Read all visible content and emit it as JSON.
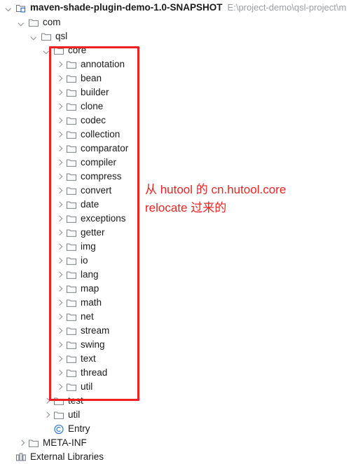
{
  "project": {
    "name": "maven-shade-plugin-demo-1.0-SNAPSHOT",
    "path": "E:\\project-demo\\qsl-project\\m",
    "icon": "project-folder-icon",
    "expanded": true
  },
  "tree": [
    {
      "label": "com",
      "icon": "folder-icon",
      "state": "expanded",
      "depth": 1
    },
    {
      "label": "qsl",
      "icon": "folder-icon",
      "state": "expanded",
      "depth": 2
    },
    {
      "label": "core",
      "icon": "folder-icon",
      "state": "expanded",
      "depth": 3
    },
    {
      "label": "annotation",
      "icon": "folder-icon",
      "state": "collapsed",
      "depth": 4
    },
    {
      "label": "bean",
      "icon": "folder-icon",
      "state": "collapsed",
      "depth": 4
    },
    {
      "label": "builder",
      "icon": "folder-icon",
      "state": "collapsed",
      "depth": 4
    },
    {
      "label": "clone",
      "icon": "folder-icon",
      "state": "collapsed",
      "depth": 4
    },
    {
      "label": "codec",
      "icon": "folder-icon",
      "state": "collapsed",
      "depth": 4
    },
    {
      "label": "collection",
      "icon": "folder-icon",
      "state": "collapsed",
      "depth": 4
    },
    {
      "label": "comparator",
      "icon": "folder-icon",
      "state": "collapsed",
      "depth": 4
    },
    {
      "label": "compiler",
      "icon": "folder-icon",
      "state": "collapsed",
      "depth": 4
    },
    {
      "label": "compress",
      "icon": "folder-icon",
      "state": "collapsed",
      "depth": 4
    },
    {
      "label": "convert",
      "icon": "folder-icon",
      "state": "collapsed",
      "depth": 4
    },
    {
      "label": "date",
      "icon": "folder-icon",
      "state": "collapsed",
      "depth": 4
    },
    {
      "label": "exceptions",
      "icon": "folder-icon",
      "state": "collapsed",
      "depth": 4
    },
    {
      "label": "getter",
      "icon": "folder-icon",
      "state": "collapsed",
      "depth": 4
    },
    {
      "label": "img",
      "icon": "folder-icon",
      "state": "collapsed",
      "depth": 4
    },
    {
      "label": "io",
      "icon": "folder-icon",
      "state": "collapsed",
      "depth": 4
    },
    {
      "label": "lang",
      "icon": "folder-icon",
      "state": "collapsed",
      "depth": 4
    },
    {
      "label": "map",
      "icon": "folder-icon",
      "state": "collapsed",
      "depth": 4
    },
    {
      "label": "math",
      "icon": "folder-icon",
      "state": "collapsed",
      "depth": 4
    },
    {
      "label": "net",
      "icon": "folder-icon",
      "state": "collapsed",
      "depth": 4
    },
    {
      "label": "stream",
      "icon": "folder-icon",
      "state": "collapsed",
      "depth": 4
    },
    {
      "label": "swing",
      "icon": "folder-icon",
      "state": "collapsed",
      "depth": 4
    },
    {
      "label": "text",
      "icon": "folder-icon",
      "state": "collapsed",
      "depth": 4
    },
    {
      "label": "thread",
      "icon": "folder-icon",
      "state": "collapsed",
      "depth": 4
    },
    {
      "label": "util",
      "icon": "folder-icon",
      "state": "collapsed",
      "depth": 4
    },
    {
      "label": "test",
      "icon": "folder-icon",
      "state": "collapsed",
      "depth": 3
    },
    {
      "label": "util",
      "icon": "folder-icon",
      "state": "collapsed",
      "depth": 3
    },
    {
      "label": "Entry",
      "icon": "java-class-icon",
      "state": "leaf",
      "depth": 3
    },
    {
      "label": "META-INF",
      "icon": "folder-icon",
      "state": "collapsed",
      "depth": 1
    },
    {
      "label": "External Libraries",
      "icon": "external-libraries-icon",
      "state": "leaf",
      "depth": 0
    }
  ],
  "annotation": {
    "text": "从 hutool 的 cn.hutool.core\nrelocate 过来的",
    "color": "#ee2222",
    "box_color": "#ee2020"
  }
}
